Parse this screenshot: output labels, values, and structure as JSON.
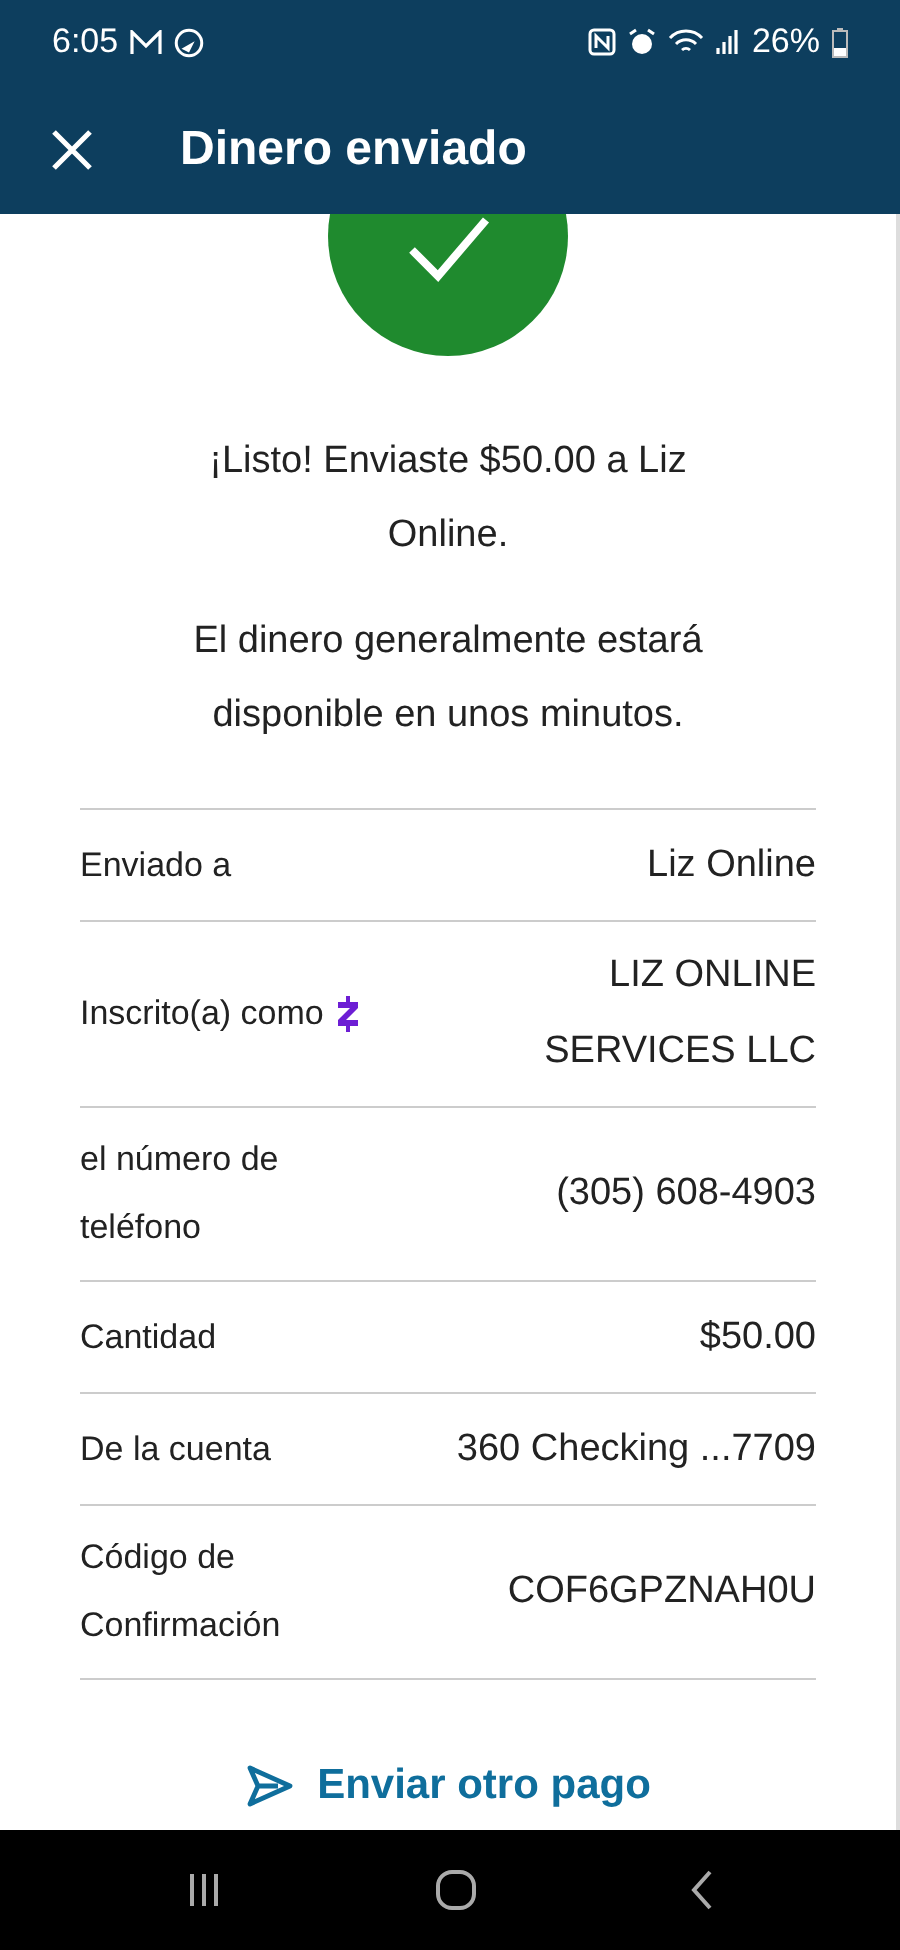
{
  "status_bar": {
    "time": "6:05",
    "battery": "26%"
  },
  "app_bar": {
    "title": "Dinero enviado"
  },
  "message": {
    "headline": "¡Listo! Enviaste $50.00 a Liz Online.",
    "note": "El dinero generalmente estará disponible en unos minutos."
  },
  "details": [
    {
      "label": "Enviado a",
      "value": "Liz Online"
    },
    {
      "label": "Inscrito(a) como",
      "value": "LIZ ONLINE SERVICES LLC",
      "kind": "zelle"
    },
    {
      "label": "el número de teléfono",
      "value": "(305) 608-4903"
    },
    {
      "label": "Cantidad",
      "value": "$50.00"
    },
    {
      "label": "De la cuenta",
      "value": "360 Checking ...7709"
    },
    {
      "label": "Código de Confirmación",
      "value": "COF6GPZNAH0U"
    }
  ],
  "action": {
    "label": "Enviar otro pago"
  }
}
